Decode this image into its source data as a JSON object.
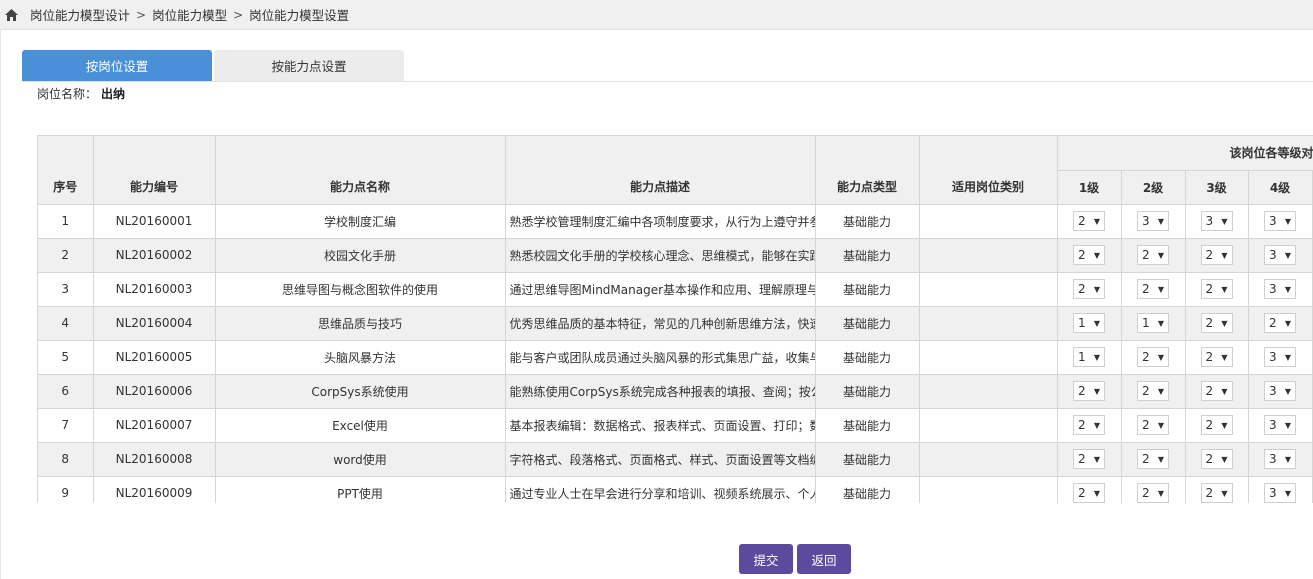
{
  "breadcrumb": {
    "icon": "home-icon",
    "items": [
      "岗位能力模型设计",
      "岗位能力模型",
      "岗位能力模型设置"
    ],
    "separator": ">"
  },
  "tabs": [
    {
      "label": "按岗位设置",
      "active": true
    },
    {
      "label": "按能力点设置",
      "active": false
    }
  ],
  "post": {
    "label": "岗位名称：",
    "value": "出纳"
  },
  "table": {
    "group_header": "该岗位各等级对应的",
    "headers": {
      "seq": "序号",
      "code": "能力编号",
      "name": "能力点名称",
      "desc": "能力点描述",
      "type": "能力点类型",
      "category": "适用岗位类别",
      "levels": [
        "1级",
        "2级",
        "3级",
        "4级"
      ]
    },
    "rows": [
      {
        "seq": "1",
        "code": "NL20160001",
        "name": "学校制度汇编",
        "desc": "熟悉学校管理制度汇编中各项制度要求，从行为上遵守并参",
        "type": "基础能力",
        "category": "",
        "levels": [
          "2",
          "3",
          "3",
          "3"
        ]
      },
      {
        "seq": "2",
        "code": "NL20160002",
        "name": "校园文化手册",
        "desc": "熟悉校园文化手册的学校核心理念、思维模式，能够在实践",
        "type": "基础能力",
        "category": "",
        "levels": [
          "2",
          "2",
          "2",
          "3"
        ]
      },
      {
        "seq": "3",
        "code": "NL20160003",
        "name": "思维导图与概念图软件的使用",
        "desc": "通过思维导图MindManager基本操作和应用、理解原理与",
        "type": "基础能力",
        "category": "",
        "levels": [
          "2",
          "2",
          "2",
          "3"
        ]
      },
      {
        "seq": "4",
        "code": "NL20160004",
        "name": "思维品质与技巧",
        "desc": "优秀思维品质的基本特征，常见的几种创新思维方法，快速",
        "type": "基础能力",
        "category": "",
        "levels": [
          "1",
          "1",
          "2",
          "2"
        ]
      },
      {
        "seq": "5",
        "code": "NL20160005",
        "name": "头脑风暴方法",
        "desc": "能与客户或团队成员通过头脑风暴的形式集思广益，收集与",
        "type": "基础能力",
        "category": "",
        "levels": [
          "1",
          "2",
          "2",
          "3"
        ]
      },
      {
        "seq": "6",
        "code": "NL20160006",
        "name": "CorpSys系统使用",
        "desc": "能熟练使用CorpSys系统完成各种报表的填报、查阅；按公",
        "type": "基础能力",
        "category": "",
        "levels": [
          "2",
          "2",
          "2",
          "3"
        ]
      },
      {
        "seq": "7",
        "code": "NL20160007",
        "name": "Excel使用",
        "desc": "基本报表编辑：数据格式、报表样式、页面设置、打印；数",
        "type": "基础能力",
        "category": "",
        "levels": [
          "2",
          "2",
          "2",
          "3"
        ]
      },
      {
        "seq": "8",
        "code": "NL20160008",
        "name": "word使用",
        "desc": "字符格式、段落格式、页面格式、样式、页面设置等文档编",
        "type": "基础能力",
        "category": "",
        "levels": [
          "2",
          "2",
          "2",
          "3"
        ]
      },
      {
        "seq": "9",
        "code": "NL20160009",
        "name": "PPT使用",
        "desc": "通过专业人士在早会进行分享和培训、视频系统展示、个人",
        "type": "基础能力",
        "category": "",
        "levels": [
          "2",
          "2",
          "2",
          "3"
        ]
      }
    ]
  },
  "buttons": {
    "submit": "提交",
    "back": "返回"
  },
  "colors": {
    "tab_active": "#4a90d9",
    "button": "#5b4a9e"
  }
}
